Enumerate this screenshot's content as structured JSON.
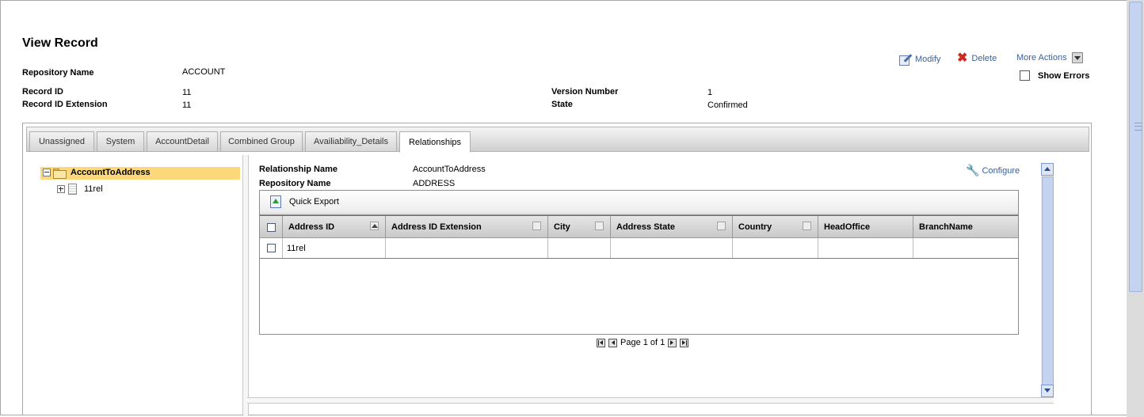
{
  "page": {
    "title": "View Record"
  },
  "record": {
    "repository_name_label": "Repository Name",
    "repository_name_value": "ACCOUNT",
    "record_id_label": "Record ID",
    "record_id_value": "11",
    "record_id_ext_label": "Record ID Extension",
    "record_id_ext_value": "11",
    "version_label": "Version Number",
    "version_value": "1",
    "state_label": "State",
    "state_value": "Confirmed"
  },
  "actions": {
    "modify": "Modify",
    "delete": "Delete",
    "more_actions": "More Actions",
    "show_errors": "Show Errors"
  },
  "tabs": [
    {
      "label": "Unassigned"
    },
    {
      "label": "System"
    },
    {
      "label": "AccountDetail"
    },
    {
      "label": "Combined Group"
    },
    {
      "label": "Availiability_Details"
    },
    {
      "label": "Relationships",
      "active": true
    }
  ],
  "tree": {
    "root": "AccountToAddress",
    "child": "11rel"
  },
  "relationship": {
    "name_label": "Relationship Name",
    "name_value": "AccountToAddress",
    "repo_label": "Repository Name",
    "repo_value": "ADDRESS",
    "configure": "Configure"
  },
  "grid": {
    "quick_export": "Quick Export",
    "columns": [
      "Address ID",
      "Address ID Extension",
      "City",
      "Address State",
      "Country",
      "HeadOffice",
      "BranchName"
    ],
    "rows": [
      [
        "11rel",
        "",
        "",
        "",
        "",
        "",
        ""
      ]
    ],
    "pager": {
      "label": "Page 1 of 1"
    }
  },
  "colors": {
    "link": "#3a5f9a",
    "tree_selection": "#fcd87a",
    "scrollbar": "#c4d3ef",
    "delete_icon": "#d02a1e"
  }
}
